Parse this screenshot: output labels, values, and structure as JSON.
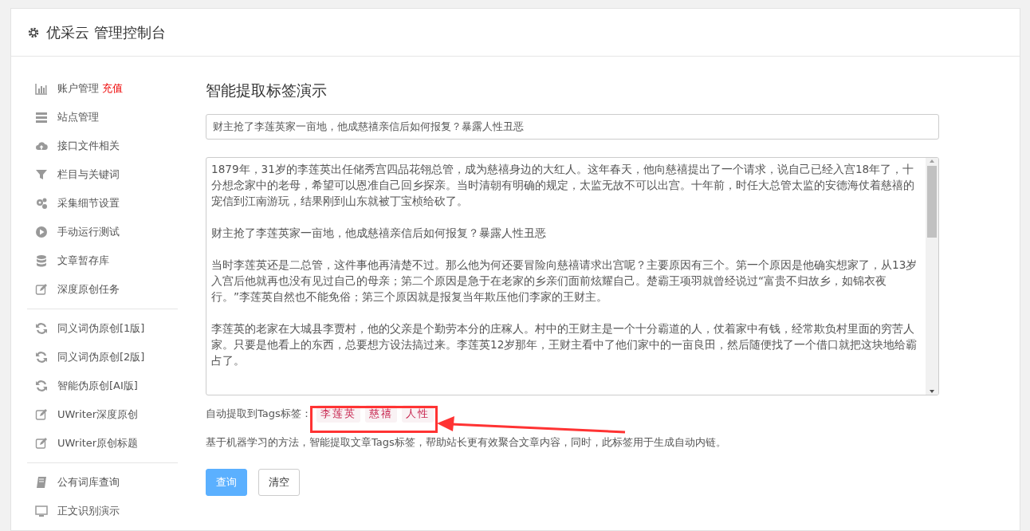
{
  "header": {
    "title": "优采云 管理控制台"
  },
  "sidebar": {
    "groups": [
      {
        "items": [
          {
            "label": "账户管理",
            "badge": "充值"
          },
          {
            "label": "站点管理"
          },
          {
            "label": "接口文件相关"
          },
          {
            "label": "栏目与关键词"
          },
          {
            "label": "采集细节设置"
          },
          {
            "label": "手动运行测试"
          },
          {
            "label": "文章暂存库"
          },
          {
            "label": "深度原创任务"
          }
        ]
      },
      {
        "items": [
          {
            "label": "同义词伪原创[1版]"
          },
          {
            "label": "同义词伪原创[2版]"
          },
          {
            "label": "智能伪原创[AI版]"
          },
          {
            "label": "UWriter深度原创"
          },
          {
            "label": "UWriter原创标题"
          }
        ]
      },
      {
        "items": [
          {
            "label": "公有词库查询"
          },
          {
            "label": "正文识别演示"
          }
        ]
      }
    ]
  },
  "main": {
    "title": "智能提取标签演示",
    "title_field": {
      "value": "财主抢了李莲英家一亩地，他成慈禧亲信后如何报复？暴露人性丑恶"
    },
    "body_field": {
      "paragraphs": [
        "1879年，31岁的李莲英出任储秀宫四品花翎总管，成为慈禧身边的大红人。这年春天，他向慈禧提出了一个请求，说自己已经入宫18年了，十分想念家中的老母，希望可以恩准自己回乡探亲。当时清朝有明确的规定，太监无故不可以出宫。十年前，时任大总管太监的安德海仗着慈禧的宠信到江南游玩，结果刚到山东就被丁宝桢给砍了。",
        "财主抢了李莲英家一亩地，他成慈禧亲信后如何报复？暴露人性丑恶",
        "当时李莲英还是二总管，这件事他再清楚不过。那么他为何还要冒险向慈禧请求出宫呢？主要原因有三个。第一个原因是他确实想家了，从13岁入宫后他就再也没有见过自己的母亲；第二个原因是急于在老家的乡亲们面前炫耀自己。楚霸王项羽就曾经说过“富贵不归故乡，如锦衣夜行。”李莲英自然也不能免俗；第三个原因就是报复当年欺压他们李家的王财主。",
        "李莲英的老家在大城县李贾村，他的父亲是个勤劳本分的庄稼人。村中的王财主是一个十分霸道的人，仗着家中有钱，经常欺负村里面的穷苦人家。只要是他看上的东西，总要想方设法搞过来。李莲英12岁那年，王财主看中了他们家中的一亩良田，然后随便找了一个借口就把这块地给霸占了。"
      ]
    },
    "tags_label": "自动提取到Tags标签：",
    "tags": [
      "李莲英",
      "慈禧",
      "人性"
    ],
    "description": "基于机器学习的方法，智能提取文章Tags标签，帮助站长更有效聚合文章内容，同时，此标签用于生成自动内链。",
    "buttons": [
      {
        "label": "查询",
        "kind": "primary"
      },
      {
        "label": "清空",
        "kind": "default"
      }
    ]
  }
}
